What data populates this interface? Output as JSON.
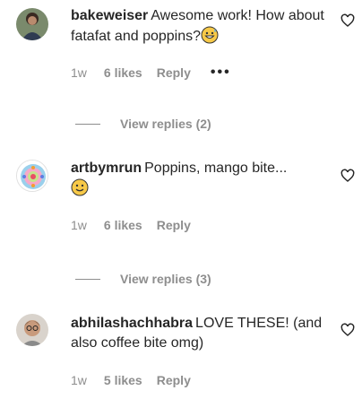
{
  "comments": [
    {
      "username": "bakeweiser",
      "text": "Awesome work! How about fatafat and poppins?",
      "emoji": "grinning-sweat-emoji",
      "time": "1w",
      "likes": "6 likes",
      "reply": "Reply",
      "more": "•••",
      "view_replies": "View replies (2)"
    },
    {
      "username": "artbymrun",
      "text": "Poppins, mango bite...",
      "emoji": "smiling-emoji",
      "time": "1w",
      "likes": "6 likes",
      "reply": "Reply",
      "view_replies": "View replies (3)"
    },
    {
      "username": "abhilashachhabra",
      "text": "LOVE THESE! (and also coffee bite omg)",
      "time": "1w",
      "likes": "5 likes",
      "reply": "Reply"
    }
  ],
  "icons": {
    "heart": "heart-outline-icon",
    "avatar": "avatar-icon"
  },
  "colors": {
    "text": "#262626",
    "muted": "#8e8e8e",
    "emoji": "#f7c948"
  }
}
